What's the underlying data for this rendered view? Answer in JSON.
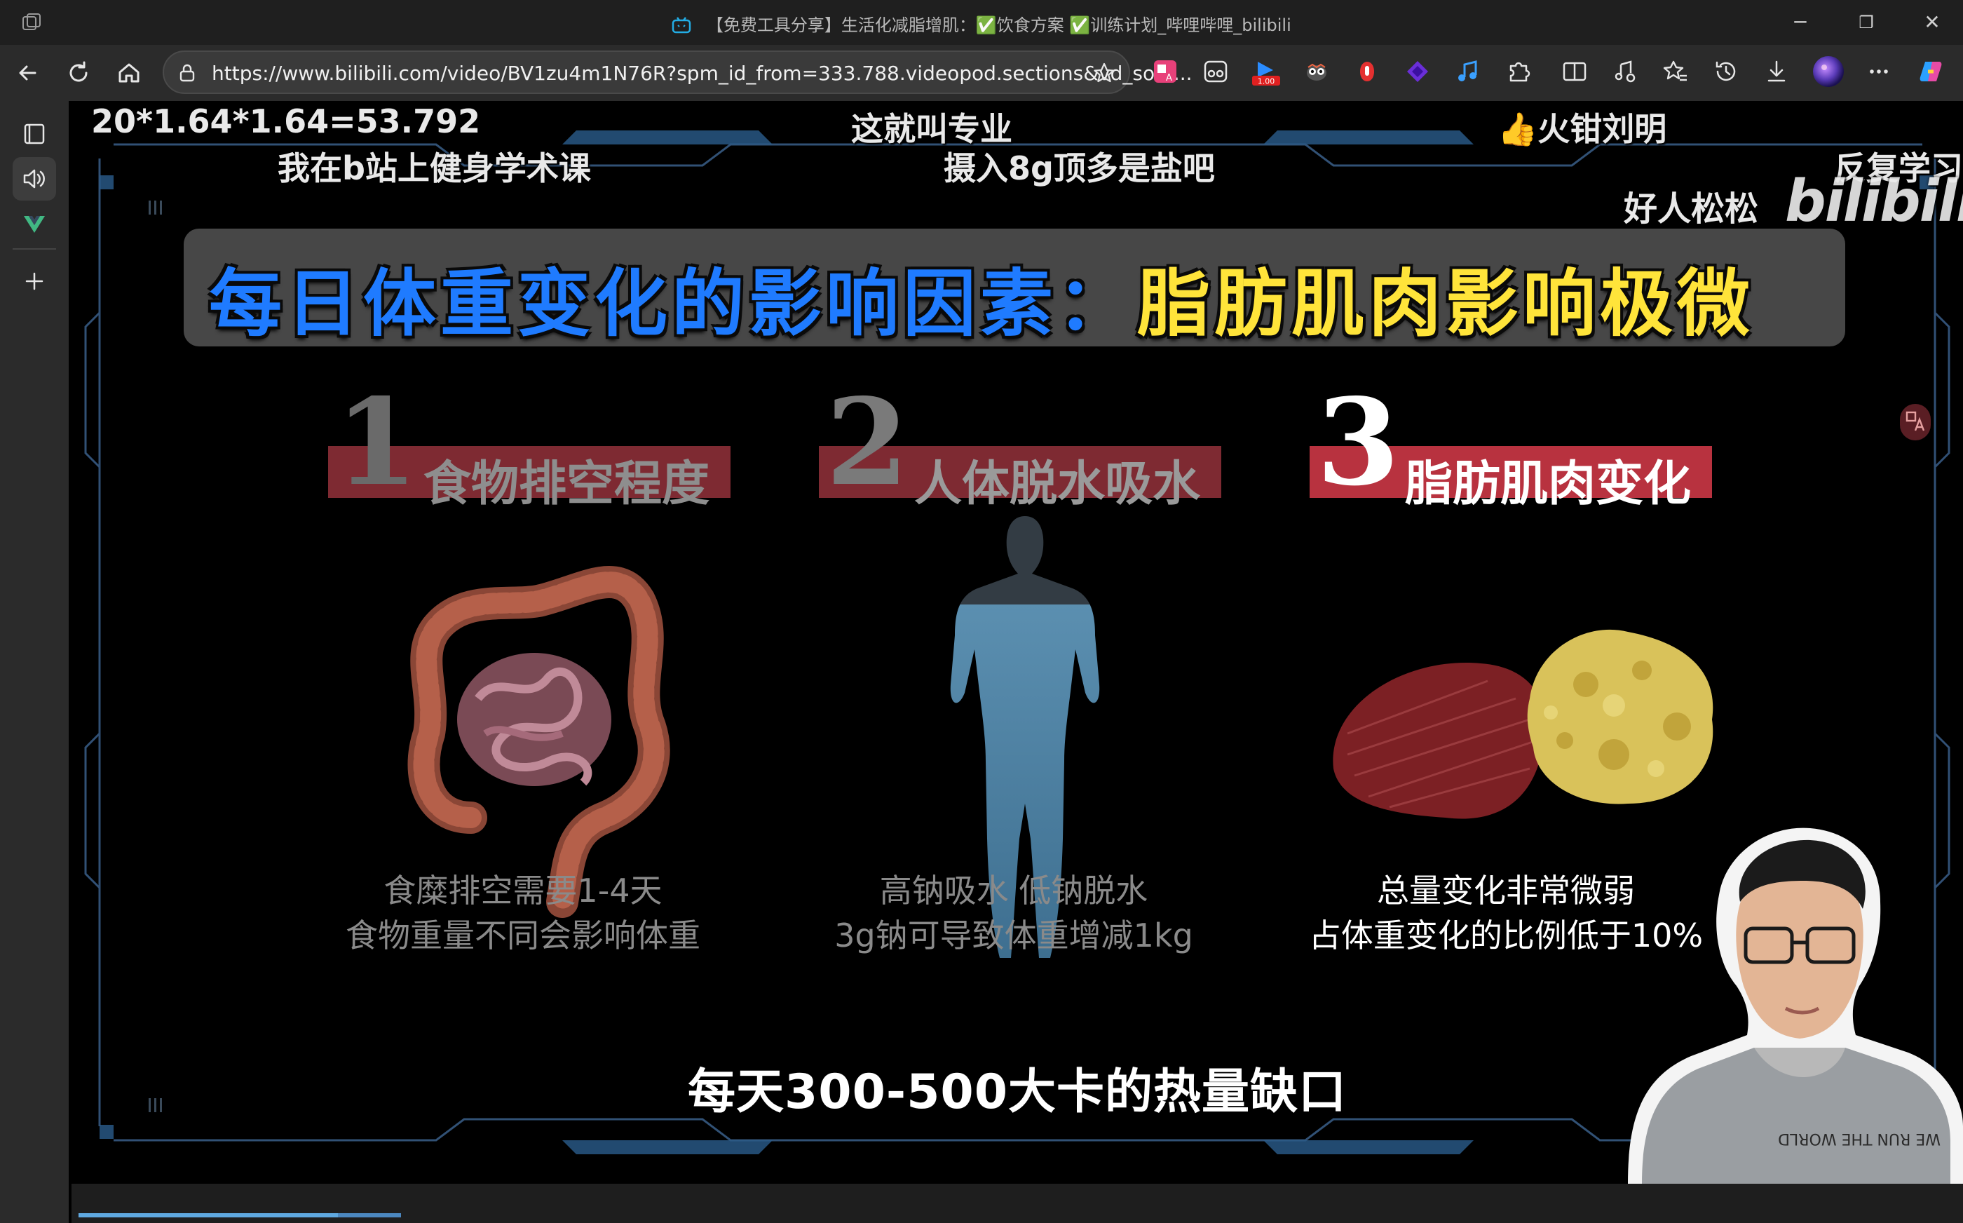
{
  "window": {
    "title": "【免费工具分享】生活化减脂增肌：✅饮食方案 ✅训练计划_哔哩哔哩_bilibili",
    "minimize": "─",
    "restore": "❐",
    "close": "✕"
  },
  "toolbar": {
    "url": "https://www.bilibili.com/video/BV1zu4m1N76R?spm_id_from=333.788.videopod.sections&vd_sour...",
    "speed_badge": "1.00"
  },
  "video": {
    "danmaku": [
      "20*1.64*1.64=53.792",
      "这就叫专业",
      "火钳刘明",
      "我在b站上健身学术课",
      "摄入8g顶多是盐吧",
      "反复学习",
      "好人松松"
    ],
    "watermark": "bilibili",
    "headline_blue": "每日体重变化的影响因素：",
    "headline_yellow": "脂肪肌肉影响极微",
    "factors": [
      {
        "number": "1",
        "label": "食物排空程度",
        "caption1": "食糜排空需要1-4天",
        "caption2": "食物重量不同会影响体重"
      },
      {
        "number": "2",
        "label": "人体脱水吸水",
        "caption1": "高钠吸水 低钠脱水",
        "caption2": "3g钠可导致体重增减1kg"
      },
      {
        "number": "3",
        "label": "脂肪肌肉变化",
        "caption1": "总量变化非常微弱",
        "caption2": "占体重变化的比例低于10%"
      }
    ],
    "subtitle": "每天300-500大卡的热量缺口",
    "shirt_text": "WE RUN THE WORLD",
    "progress": 0.14
  },
  "colors": {
    "accent_blue": "#1f7bff",
    "accent_yellow": "#ffe43a",
    "bar_red": "#a8323c",
    "bar_red_active": "#c43a4a"
  }
}
